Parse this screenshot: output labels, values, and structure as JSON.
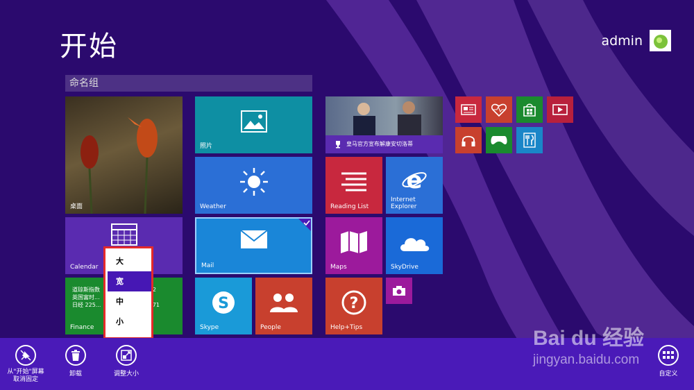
{
  "start": {
    "title": "开始",
    "user_name": "admin"
  },
  "group": {
    "name": "命名组"
  },
  "tiles": {
    "desktop": "桌面",
    "photos": "照片",
    "news": "皇马官方宣布解康安切洛蒂",
    "weather": "Weather",
    "reading_list": "Reading List",
    "ie": "Internet Explorer",
    "calendar": "Calendar",
    "mail": "Mail",
    "maps": "Maps",
    "skydrive": "SkyDrive",
    "finance": {
      "label": "Finance",
      "line1": "道琼斯指数",
      "line2": "英国富时...",
      "line3": "日经 225...",
      "val1": "2",
      "val2": "71"
    },
    "skype": "Skype",
    "people": "People",
    "help": "Help+Tips"
  },
  "resize_menu": {
    "items": [
      "大",
      "宽",
      "中",
      "小"
    ],
    "selected": "宽"
  },
  "appbar": {
    "unpin": "从\"开始\"屏幕\n取消固定",
    "uninstall": "卸载",
    "resize": "调整大小",
    "customize": "自定义"
  },
  "watermark": {
    "brand": "Bai du 经验",
    "url": "jingyan.baidu.com"
  },
  "colors": {
    "background": "#2b0a6e",
    "appbar": "#4a1ab8",
    "teal": "#0e8fa3",
    "blue": "#2b6fd6",
    "purple": "#5a2bb0",
    "red": "#c8402e",
    "green": "#1a8a2e",
    "magenta": "#9c1a9c",
    "highlight": "#e52a2a"
  }
}
